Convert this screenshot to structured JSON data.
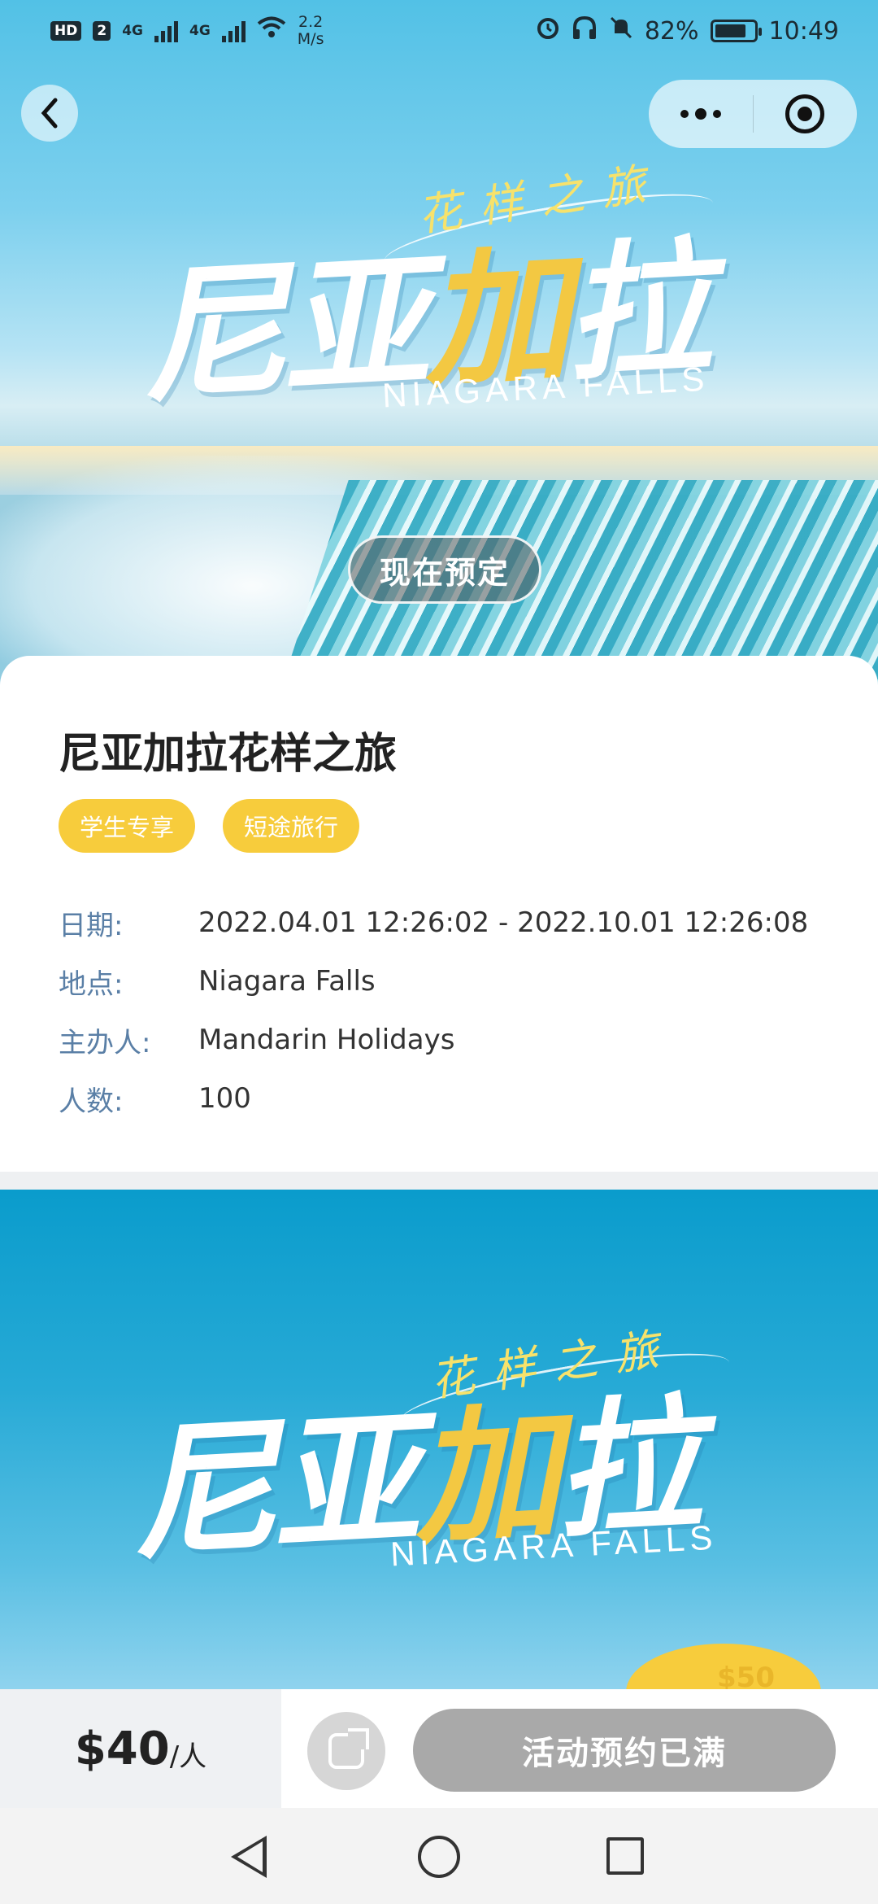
{
  "status_bar": {
    "hd_badge": "HD",
    "sim_badge": "2",
    "net1": "4G",
    "net2": "4G",
    "speed_value": "2.2",
    "speed_unit": "M/s",
    "battery_percent": "82%",
    "time": "10:49",
    "icons": [
      "alarm-icon",
      "headphones-icon",
      "mute-icon",
      "battery-icon"
    ]
  },
  "nav": {
    "back_icon": "chevron-left-icon",
    "more_icon": "more-dots-icon",
    "close_icon": "target-ring-icon"
  },
  "poster": {
    "subtitle": "花样之旅",
    "main_a": "尼亚",
    "main_hl": "加",
    "main_b": "拉",
    "english": "NIAGARA FALLS",
    "book_now": "现在预定"
  },
  "event": {
    "title": "尼亚加拉花样之旅",
    "tags": [
      "学生专享",
      "短途旅行"
    ],
    "details": [
      {
        "label": "日期:",
        "value": "2022.04.01 12:26:02 - 2022.10.01 12:26:08"
      },
      {
        "label": "地点:",
        "value": "Niagara Falls"
      },
      {
        "label": "主办人:",
        "value": "Mandarin Holidays"
      },
      {
        "label": "人数:",
        "value": "100"
      }
    ]
  },
  "banner2": {
    "subtitle": "花样之旅",
    "main_a": "尼亚",
    "main_hl": "加",
    "main_b": "拉",
    "english": "NIAGARA FALLS",
    "price_peek": "$50"
  },
  "action_bar": {
    "price": "$40",
    "unit": "/人",
    "share_icon": "share-icon",
    "full_button": "活动预约已满"
  },
  "colors": {
    "tag_yellow": "#f7cc3c",
    "label_blue": "#5a7fa6",
    "disabled_gray": "#a9a9a9"
  }
}
